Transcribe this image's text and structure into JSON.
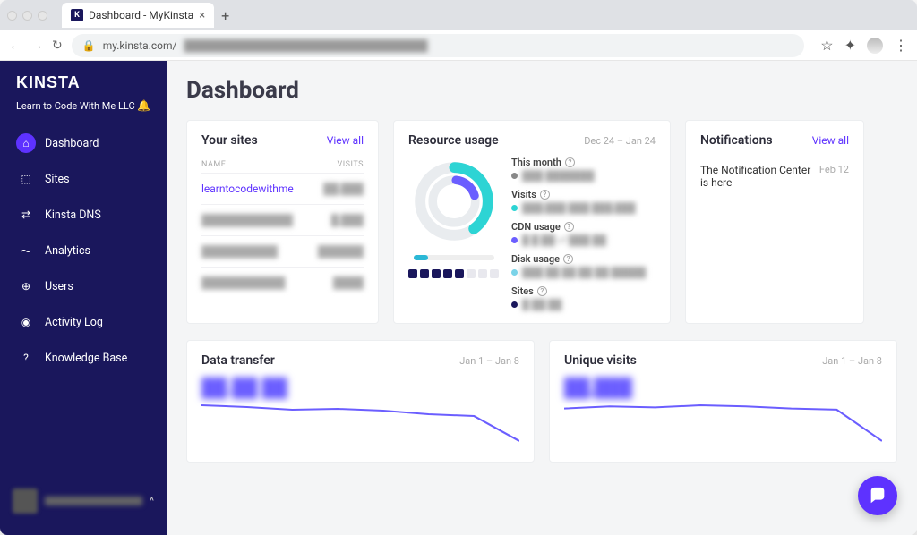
{
  "browser": {
    "tab_title": "Dashboard - MyKinsta",
    "tab_close": "×",
    "new_tab": "+",
    "url_host": "my.kinsta.com/",
    "url_path_blurred": "████████████████████████████████",
    "back": "←",
    "forward": "→",
    "reload": "↻",
    "lock": "🔒",
    "star": "☆",
    "ext": "✦",
    "menu": "⋮"
  },
  "brand": "KINSTA",
  "company": "Learn to Code With Me LLC",
  "nav": [
    {
      "icon": "⌂",
      "label": "Dashboard",
      "active": true
    },
    {
      "icon": "⬚",
      "label": "Sites"
    },
    {
      "icon": "⇄",
      "label": "Kinsta DNS"
    },
    {
      "icon": "〜",
      "label": "Analytics"
    },
    {
      "icon": "⊕",
      "label": "Users"
    },
    {
      "icon": "◉",
      "label": "Activity Log"
    },
    {
      "icon": "?",
      "label": "Knowledge Base"
    }
  ],
  "page_title": "Dashboard",
  "sites_card": {
    "title": "Your sites",
    "view_all": "View all",
    "col_name": "NAME",
    "col_visits": "VISITS",
    "rows": [
      {
        "name": "learntocodewithme",
        "visits": "██,███"
      },
      {
        "name": "████████████",
        "visits": "█,███"
      },
      {
        "name": "██████████",
        "visits": "██████"
      },
      {
        "name": "███████████",
        "visits": "████"
      }
    ]
  },
  "resource_card": {
    "title": "Resource usage",
    "range": "Dec 24 – Jan 24",
    "metrics": [
      {
        "label": "This month",
        "dot": "#888",
        "value": "███ ███████"
      },
      {
        "label": "Visits",
        "dot": "#2dd4d4",
        "value": "███,███ ███ ███,███"
      },
      {
        "label": "CDN usage",
        "dot": "#6b5eff",
        "value": "█ █ ██ of ███ ██"
      },
      {
        "label": "Disk usage",
        "dot": "#7ad3e8",
        "value": "███ ██ ██ ██ ██ █████"
      },
      {
        "label": "Sites",
        "dot": "#1a175c",
        "value": "█ ██ ██"
      }
    ]
  },
  "notif_card": {
    "title": "Notifications",
    "view_all": "View all",
    "items": [
      {
        "text": "The Notification Center is here",
        "date": "Feb 12"
      }
    ]
  },
  "data_transfer": {
    "title": "Data transfer",
    "range": "Jan 1 – Jan 8",
    "stat": "██.██ ██"
  },
  "unique_visits": {
    "title": "Unique visits",
    "range": "Jan 1 – Jan 8",
    "stat": "██,███"
  },
  "chart_data": [
    {
      "type": "line",
      "name": "data_transfer_sparkline",
      "x": [
        1,
        2,
        3,
        4,
        5,
        6,
        7,
        8
      ],
      "values": [
        60,
        58,
        55,
        56,
        54,
        50,
        48,
        20
      ],
      "color": "#6b5eff",
      "title": "Data transfer"
    },
    {
      "type": "line",
      "name": "unique_visits_sparkline",
      "x": [
        1,
        2,
        3,
        4,
        5,
        6,
        7,
        8
      ],
      "values": [
        48,
        50,
        49,
        51,
        50,
        48,
        47,
        18
      ],
      "color": "#6b5eff",
      "title": "Unique visits"
    }
  ]
}
